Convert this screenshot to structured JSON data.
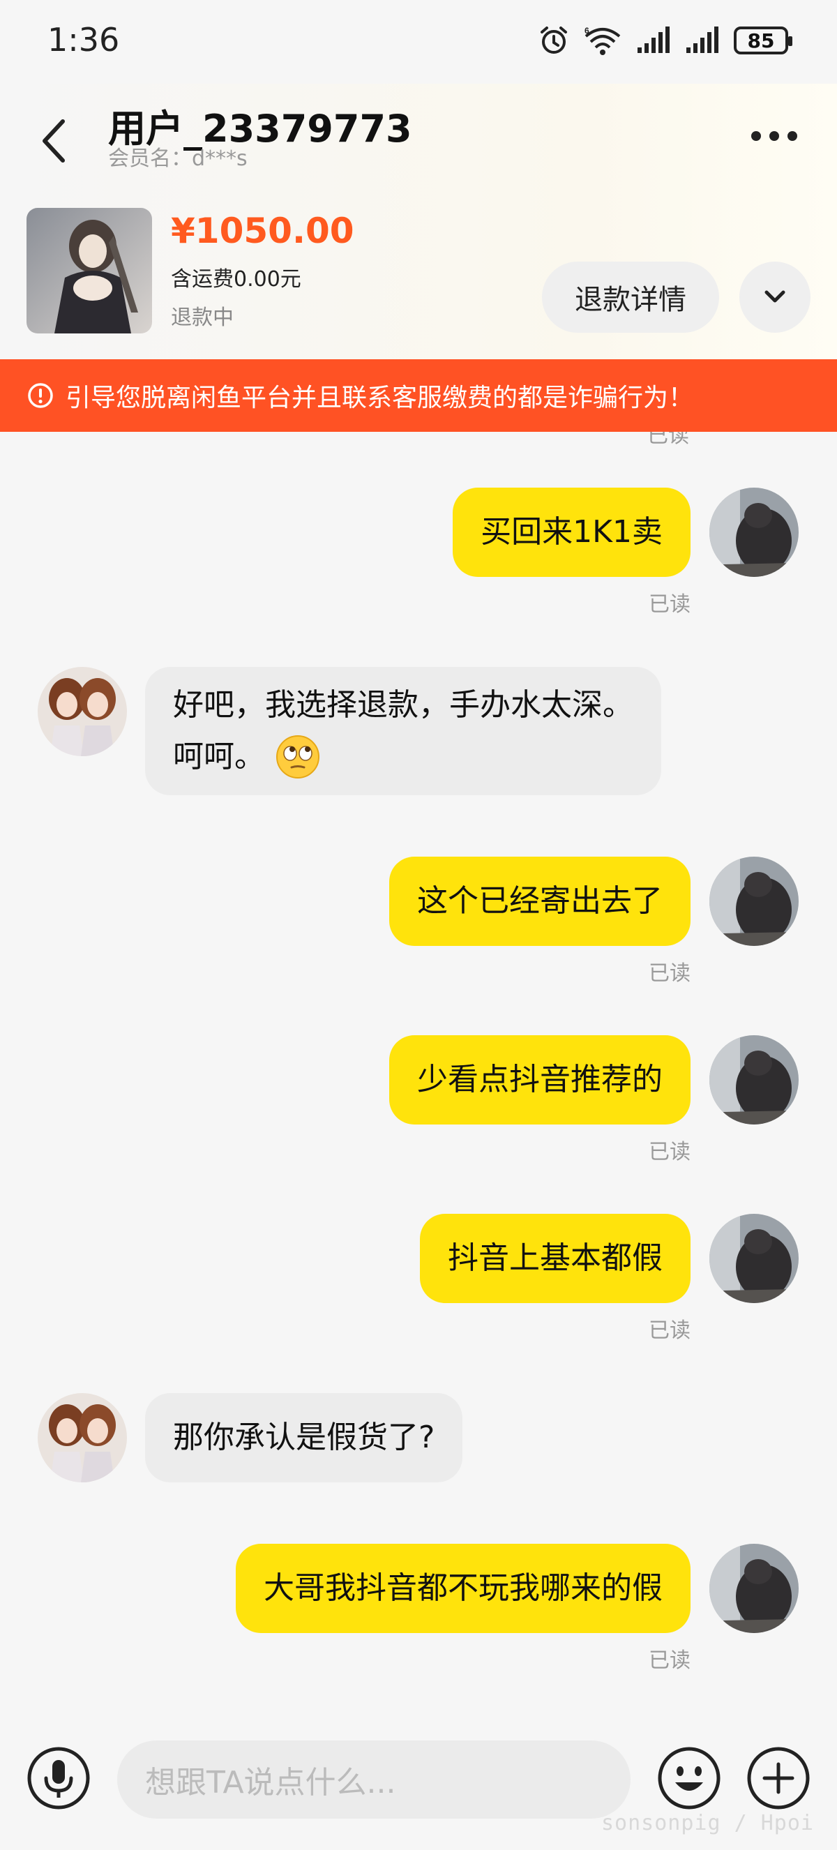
{
  "status_bar": {
    "time": "1:36",
    "battery": "85",
    "icons": [
      "alarm-icon",
      "wifi-6-icon",
      "signal-icon",
      "signal-icon",
      "battery-icon"
    ]
  },
  "header": {
    "title": "用户_23379773",
    "subtitle": "会员名：d***s",
    "back_icon": "chevron-left-icon",
    "more_icon": "more-dots-icon"
  },
  "product": {
    "price": "¥1050.00",
    "shipping": "含运费0.00元",
    "status": "退款中",
    "refund_button": "退款详情",
    "expand_icon": "chevron-down-icon"
  },
  "warning": {
    "text": "引导您脱离闲鱼平台并且联系客服缴费的都是诈骗行为！",
    "icon": "exclamation-circle-icon",
    "color": "#ff5224"
  },
  "chat": {
    "top_read_label": "已读",
    "messages": [
      {
        "sender": "me",
        "text": "买回来1K1卖",
        "read": "已读"
      },
      {
        "sender": "other",
        "line1": "好吧，我选择退款，手办水太深。",
        "line2": "呵呵。",
        "emoji": "rolling-eyes-face-icon"
      },
      {
        "sender": "me",
        "text": "这个已经寄出去了",
        "read": "已读"
      },
      {
        "sender": "me",
        "text": "少看点抖音推荐的",
        "read": "已读"
      },
      {
        "sender": "me",
        "text": "抖音上基本都假",
        "read": "已读"
      },
      {
        "sender": "other",
        "text": "那你承认是假货了?"
      },
      {
        "sender": "me",
        "text": "大哥我抖音都不玩我哪来的假",
        "read": "已读"
      }
    ]
  },
  "input": {
    "placeholder": "想跟TA说点什么...",
    "voice_icon": "microphone-icon",
    "emoji_icon": "smiley-icon",
    "plus_icon": "plus-circle-icon"
  },
  "watermark": "sonsonpig / Hpoi",
  "colors": {
    "my_bubble": "#ffe30c",
    "other_bubble": "#ececec",
    "price": "#ff5a1f"
  }
}
